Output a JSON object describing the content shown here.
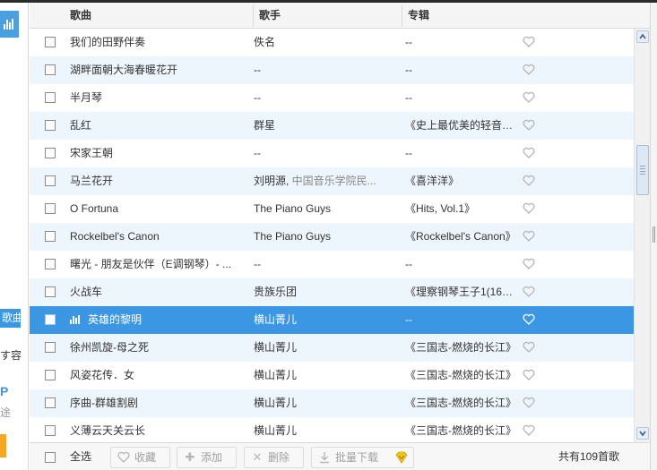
{
  "header": {
    "song": "歌曲",
    "artist": "歌手",
    "album": "专辑"
  },
  "rows": [
    {
      "song": "我们的田野伴奏",
      "artist": "佚名",
      "artist_extra": "",
      "album": "--"
    },
    {
      "song": "湖畔面朝大海春暖花开",
      "artist": "--",
      "artist_extra": "",
      "album": "--"
    },
    {
      "song": "半月琴",
      "artist": "--",
      "artist_extra": "",
      "album": "--"
    },
    {
      "song": "乱红",
      "artist": "群星",
      "artist_extra": "",
      "album": "《史上最优美的轻音乐(Di..."
    },
    {
      "song": "宋家王朝",
      "artist": "--",
      "artist_extra": "",
      "album": "--"
    },
    {
      "song": "马兰花开",
      "artist": "刘明源,",
      "artist_extra": " 中国音乐学院民...",
      "album": "《喜洋洋》"
    },
    {
      "song": "O Fortuna",
      "artist": "The Piano Guys",
      "artist_extra": "",
      "album": "《Hits, Vol.1》"
    },
    {
      "song": "Rockelbel's Canon",
      "artist": "The Piano Guys",
      "artist_extra": "",
      "album": "《Rockelbel's Canon》"
    },
    {
      "song": "曙光 - 朋友是伙伴（E调钢琴）- ...",
      "artist": "--",
      "artist_extra": "",
      "album": "--"
    },
    {
      "song": "火战车",
      "artist": "贵族乐团",
      "artist_extra": "",
      "album": "《理察钢琴王子1(16首水..."
    },
    {
      "song": "英雄的黎明",
      "artist": "横山菁儿",
      "artist_extra": "",
      "album": "--",
      "selected": true
    },
    {
      "song": "徐州凯旋-母之死",
      "artist": "横山菁儿",
      "artist_extra": "",
      "album": "《三国志-燃烧的长江》"
    },
    {
      "song": "风姿花传．女",
      "artist": "横山菁儿",
      "artist_extra": "",
      "album": "《三国志-燃烧的长江》"
    },
    {
      "song": "序曲-群雄割剧",
      "artist": "横山菁儿",
      "artist_extra": "",
      "album": "《三国志-燃烧的长江》"
    },
    {
      "song": "义薄云天关云长",
      "artist": "横山菁儿",
      "artist_extra": "",
      "album": "《三国志-燃烧的长江》"
    }
  ],
  "footer": {
    "select_all": "全选",
    "collect": "收藏",
    "add": "添加",
    "delete": "删除",
    "batch_download": "批量下载",
    "count": "共有109首歌"
  },
  "sidebar_fragment": {
    "song_tab": "歌曲",
    "text_fragment": "す容",
    "letter": "P",
    "gray_text": "途"
  },
  "colors": {
    "selected_row": "#3b97e3",
    "alt_row": "#eef6fd",
    "accent": "#3b97e3",
    "vip_orange": "#f5a623"
  },
  "icons": {
    "heart": "heart-outline-icon",
    "collect": "heart-icon",
    "add": "plus-icon",
    "delete": "x-icon",
    "download": "download-icon"
  }
}
